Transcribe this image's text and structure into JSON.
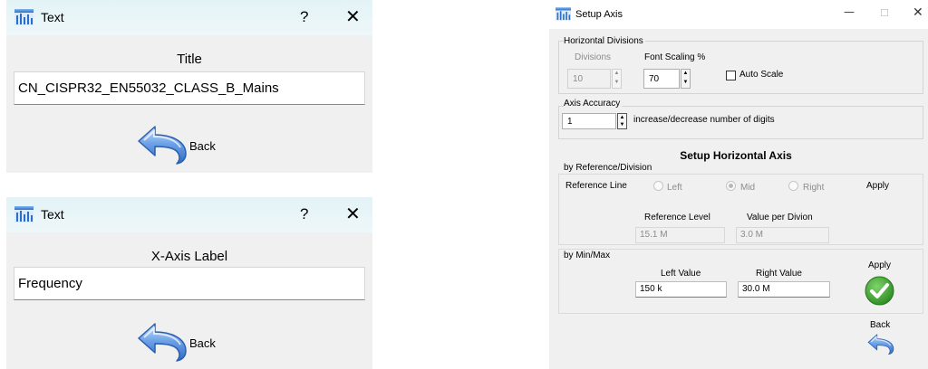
{
  "title_dialog": {
    "window_title": "Text",
    "help": "?",
    "close": "✕",
    "heading": "Title",
    "value": "CN_CISPR32_EN55032_CLASS_B_Mains",
    "back_label": "Back"
  },
  "xaxis_dialog": {
    "window_title": "Text",
    "help": "?",
    "close": "✕",
    "heading": "X-Axis Label",
    "value": "Frequency",
    "back_label": "Back"
  },
  "setup_axis": {
    "window_title": "Setup Axis",
    "controls": {
      "minimize": "—",
      "maximize": "☐",
      "close": "✕"
    },
    "horizontal_divisions": {
      "group_label": "Horizontal Divisions",
      "divisions_label": "Divisions",
      "divisions_value": "10",
      "font_scaling_label": "Font Scaling %",
      "font_scaling_value": "70",
      "auto_scale_label": "Auto Scale",
      "auto_scale_checked": false
    },
    "axis_accuracy": {
      "group_label": "Axis Accuracy",
      "value": "1",
      "hint": "increase/decrease number of digits"
    },
    "horizontal_axis": {
      "heading": "Setup Horizontal Axis",
      "by_reference_label": "by Reference/Division",
      "reference_line_label": "Reference Line",
      "options": [
        "Left",
        "Mid",
        "Right"
      ],
      "selected": "Mid",
      "apply_label": "Apply",
      "reference_level_label": "Reference Level",
      "reference_level_value": "15.1 M",
      "value_per_division_label": "Value per Divion",
      "value_per_division_value": "3.0 M"
    },
    "min_max": {
      "group_label": "by Min/Max",
      "left_value_label": "Left Value",
      "left_value": "150 k",
      "right_value_label": "Right Value",
      "right_value": "30.0 M",
      "apply_label": "Apply"
    },
    "back_label": "Back"
  },
  "colors": {
    "titlebar": "#e6f5f8",
    "dialog_bg": "#f0f0f0",
    "apply_green": "#3aa02c",
    "back_blue": "#4a86d8"
  }
}
